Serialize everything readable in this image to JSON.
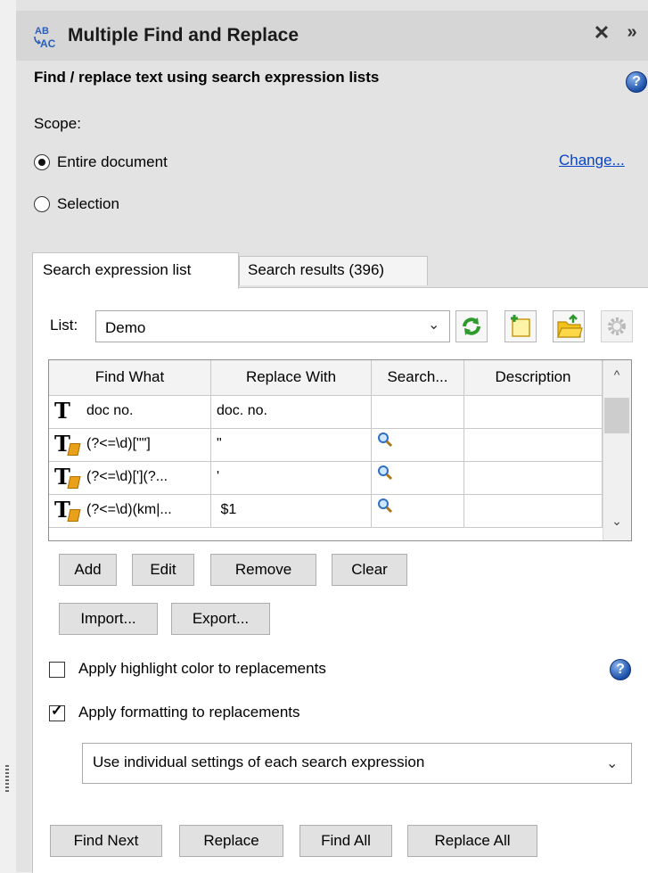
{
  "panel": {
    "title": "Multiple Find and Replace",
    "close_glyph": "✕",
    "expand_glyph": "»",
    "icon": "ab-ac-replace-icon"
  },
  "subtitle": "Find / replace text using search expression lists",
  "help_glyph": "?",
  "scope": {
    "label": "Scope:",
    "options": [
      "Entire document",
      "Selection"
    ],
    "selected": "Entire document",
    "change_link": "Change..."
  },
  "tabs": [
    {
      "label": "Search expression list",
      "active": true
    },
    {
      "label": "Search results (396)",
      "active": false
    }
  ],
  "list": {
    "label": "List:",
    "value": "Demo",
    "chevron": "⌄",
    "tools": [
      "refresh-icon",
      "new-list-icon",
      "open-folder-icon",
      "settings-gear-icon"
    ]
  },
  "grid": {
    "headers": [
      "Find What",
      "Replace With",
      "Search...",
      "Description"
    ],
    "rows": [
      {
        "icon": "text-icon",
        "find": "doc no.",
        "replace": "doc. no.",
        "search": "",
        "description": ""
      },
      {
        "icon": "regex-text-icon",
        "find": "(?<=\\d)[\"\"]",
        "replace": "\"",
        "search": "magnifier-icon",
        "description": ""
      },
      {
        "icon": "regex-text-icon",
        "find": "(?<=\\d)['](?...",
        "replace": "'",
        "search": "magnifier-icon",
        "description": ""
      },
      {
        "icon": "regex-text-icon",
        "find": "(?<=\\d)(km|...",
        "replace": " $1",
        "search": "magnifier-icon",
        "description": ""
      }
    ],
    "scroll_up": "^",
    "scroll_down": "⌄"
  },
  "buttons": {
    "add": "Add",
    "edit": "Edit",
    "remove": "Remove",
    "clear": "Clear",
    "import": "Import...",
    "export": "Export...",
    "find_next": "Find Next",
    "replace": "Replace",
    "find_all": "Find All",
    "replace_all": "Replace All"
  },
  "options": {
    "highlight_label": "Apply highlight color to replacements",
    "highlight_checked": false,
    "format_label": "Apply formatting to replacements",
    "format_checked": true,
    "format_mode": "Use individual settings of each search expression",
    "check_glyph": "✓"
  },
  "colors": {
    "link": "#0645c6",
    "help": "#1b4fa8",
    "regex_badge": "#e9a11a"
  }
}
